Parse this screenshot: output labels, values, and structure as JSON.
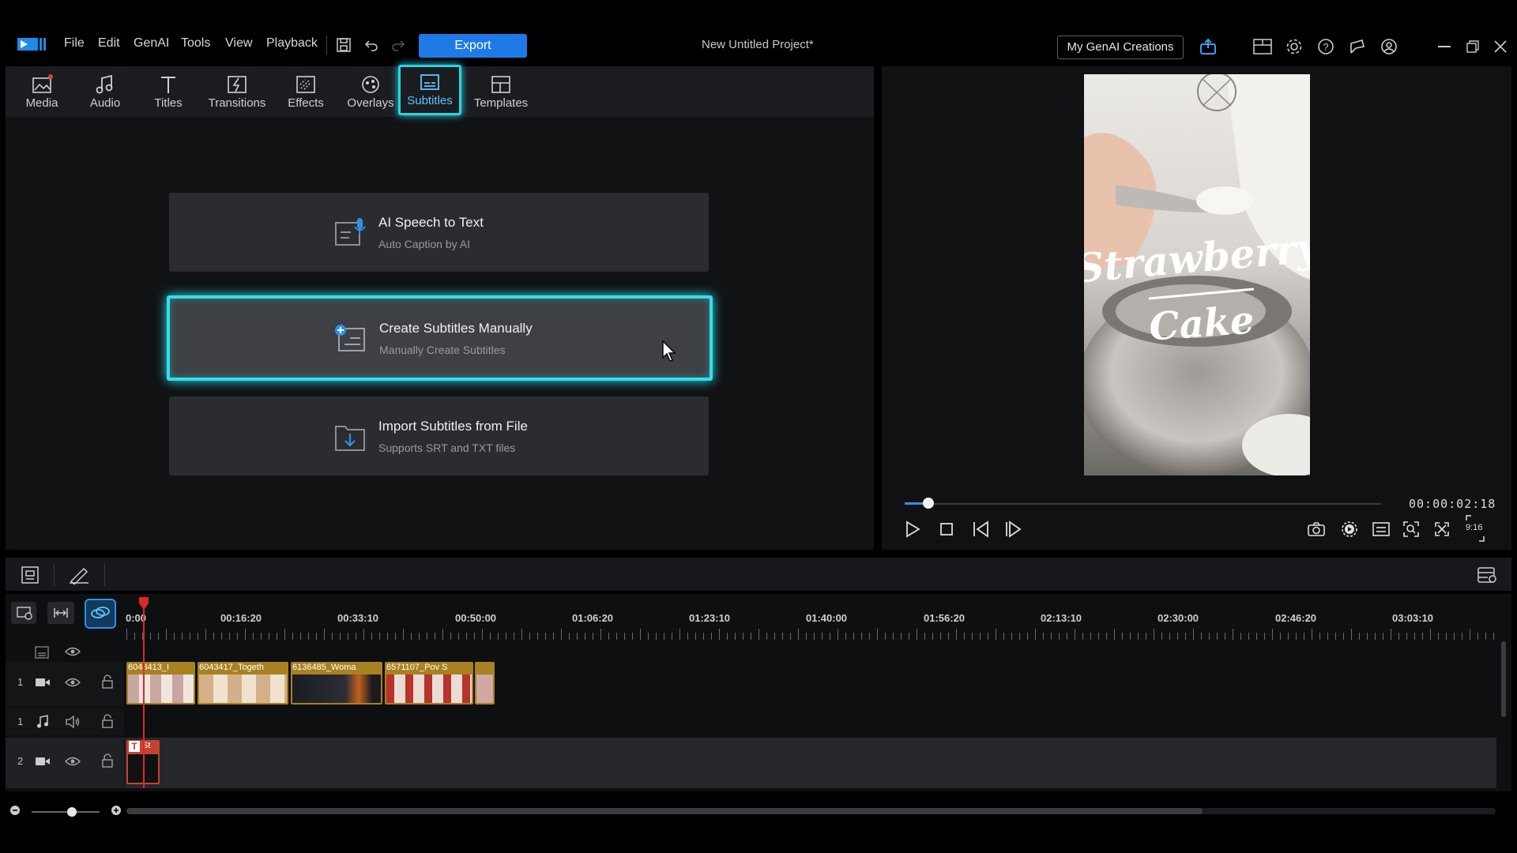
{
  "menu": [
    "File",
    "Edit",
    "GenAI",
    "Tools",
    "View",
    "Playback"
  ],
  "export_label": "Export",
  "project_title": "New Untitled Project*",
  "genai_button": "My GenAI Creations",
  "tabs": [
    {
      "label": "Media",
      "icon": "media-icon"
    },
    {
      "label": "Audio",
      "icon": "music-note-icon"
    },
    {
      "label": "Titles",
      "icon": "title-t-icon"
    },
    {
      "label": "Transitions",
      "icon": "transition-icon"
    },
    {
      "label": "Effects",
      "icon": "effects-icon"
    },
    {
      "label": "Overlays",
      "icon": "overlay-icon"
    },
    {
      "label": "Subtitles",
      "icon": "subtitles-icon",
      "active": true
    },
    {
      "label": "Templates",
      "icon": "templates-icon"
    }
  ],
  "options": [
    {
      "title": "AI Speech to Text",
      "subtitle": "Auto Caption by AI",
      "icon": "speech-to-text-icon"
    },
    {
      "title": "Create Subtitles Manually",
      "subtitle": "Manually Create Subtitles",
      "icon": "add-subtitle-icon",
      "highlighted": true
    },
    {
      "title": "Import Subtitles from File",
      "subtitle": "Supports SRT and TXT files",
      "icon": "import-file-icon"
    }
  ],
  "preview": {
    "overlay_line1": "Strawberry",
    "overlay_line2": "Cake",
    "timecode": "00:00:02:18",
    "aspect": "9:16",
    "progress_fraction": 0.05
  },
  "timeline": {
    "ruler": [
      "0:00",
      "00:16:20",
      "00:33:10",
      "00:50:00",
      "01:06:20",
      "01:23:10",
      "01:40:00",
      "01:56:20",
      "02:13:10",
      "02:30:00",
      "02:46:20",
      "03:03:10"
    ],
    "tracks": [
      {
        "number": "1",
        "type": "video"
      },
      {
        "number": "1",
        "type": "audio"
      },
      {
        "number": "2",
        "type": "video"
      }
    ],
    "clips": [
      "6043413_I",
      "6043417_Togeth",
      "6136485_Woma",
      "6571107_Pov S",
      ""
    ],
    "title_clip": "St"
  },
  "colors": {
    "accent": "#1f7ae8",
    "highlight": "#2ee0ee",
    "clip": "#a88120",
    "playhead": "#e0262c"
  }
}
